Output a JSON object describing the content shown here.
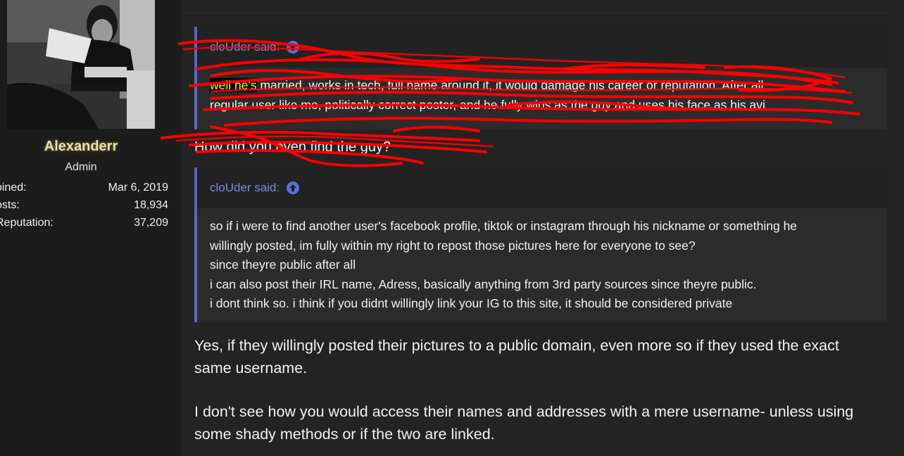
{
  "profile": {
    "username": "Alexanderr",
    "title": "Admin",
    "stats": [
      {
        "label": "oined:",
        "value": "Mar 6, 2019"
      },
      {
        "label": "osts:",
        "value": "18,934"
      },
      {
        "label": "Reputation:",
        "value": "37,209"
      }
    ]
  },
  "quote1": {
    "author": "cloUder said:",
    "line1_highlight": "well he's",
    "line1_rest": " married, works in tech, full name around it, it would damage his career or reputation. After all",
    "line2": "regular user like me, politically correct poster, and he fully wins as the guy and uses his face as his avi"
  },
  "redacted_question": "How did you even find the guy?",
  "quote2": {
    "author": "cloUder said:",
    "lines": [
      "so if i were to find another user's facebook profile, tiktok or instagram through his nickname or something he",
      "willingly posted, im fully within my right to repost those pictures here for everyone to see?",
      "since theyre public after all",
      "i can also post their IRL name, Adress, basically anything from 3rd party sources since theyre public.",
      "i dont think so. i think if you didnt willingly link your IG to this site, it should be considered private"
    ]
  },
  "reply": {
    "paragraph1_line1": "Yes, if they willingly posted their pictures to a public domain, even more so if they used the exact",
    "paragraph1_line2": "same username.",
    "paragraph2_line1": "I don't see how you would access their names and addresses with a mere username- unless using",
    "paragraph2_line2": "some shady methods or if the two are linked."
  },
  "colors": {
    "background": "#1c1c1c",
    "quote_border": "#5865c8",
    "quote_author": "#7b8ae0",
    "username": "#e6dfb2",
    "highlight_text": "#f3ff3a",
    "scribble": "#ff0000"
  },
  "icons": {
    "quote_jump": "arrow-up-circle-icon"
  }
}
